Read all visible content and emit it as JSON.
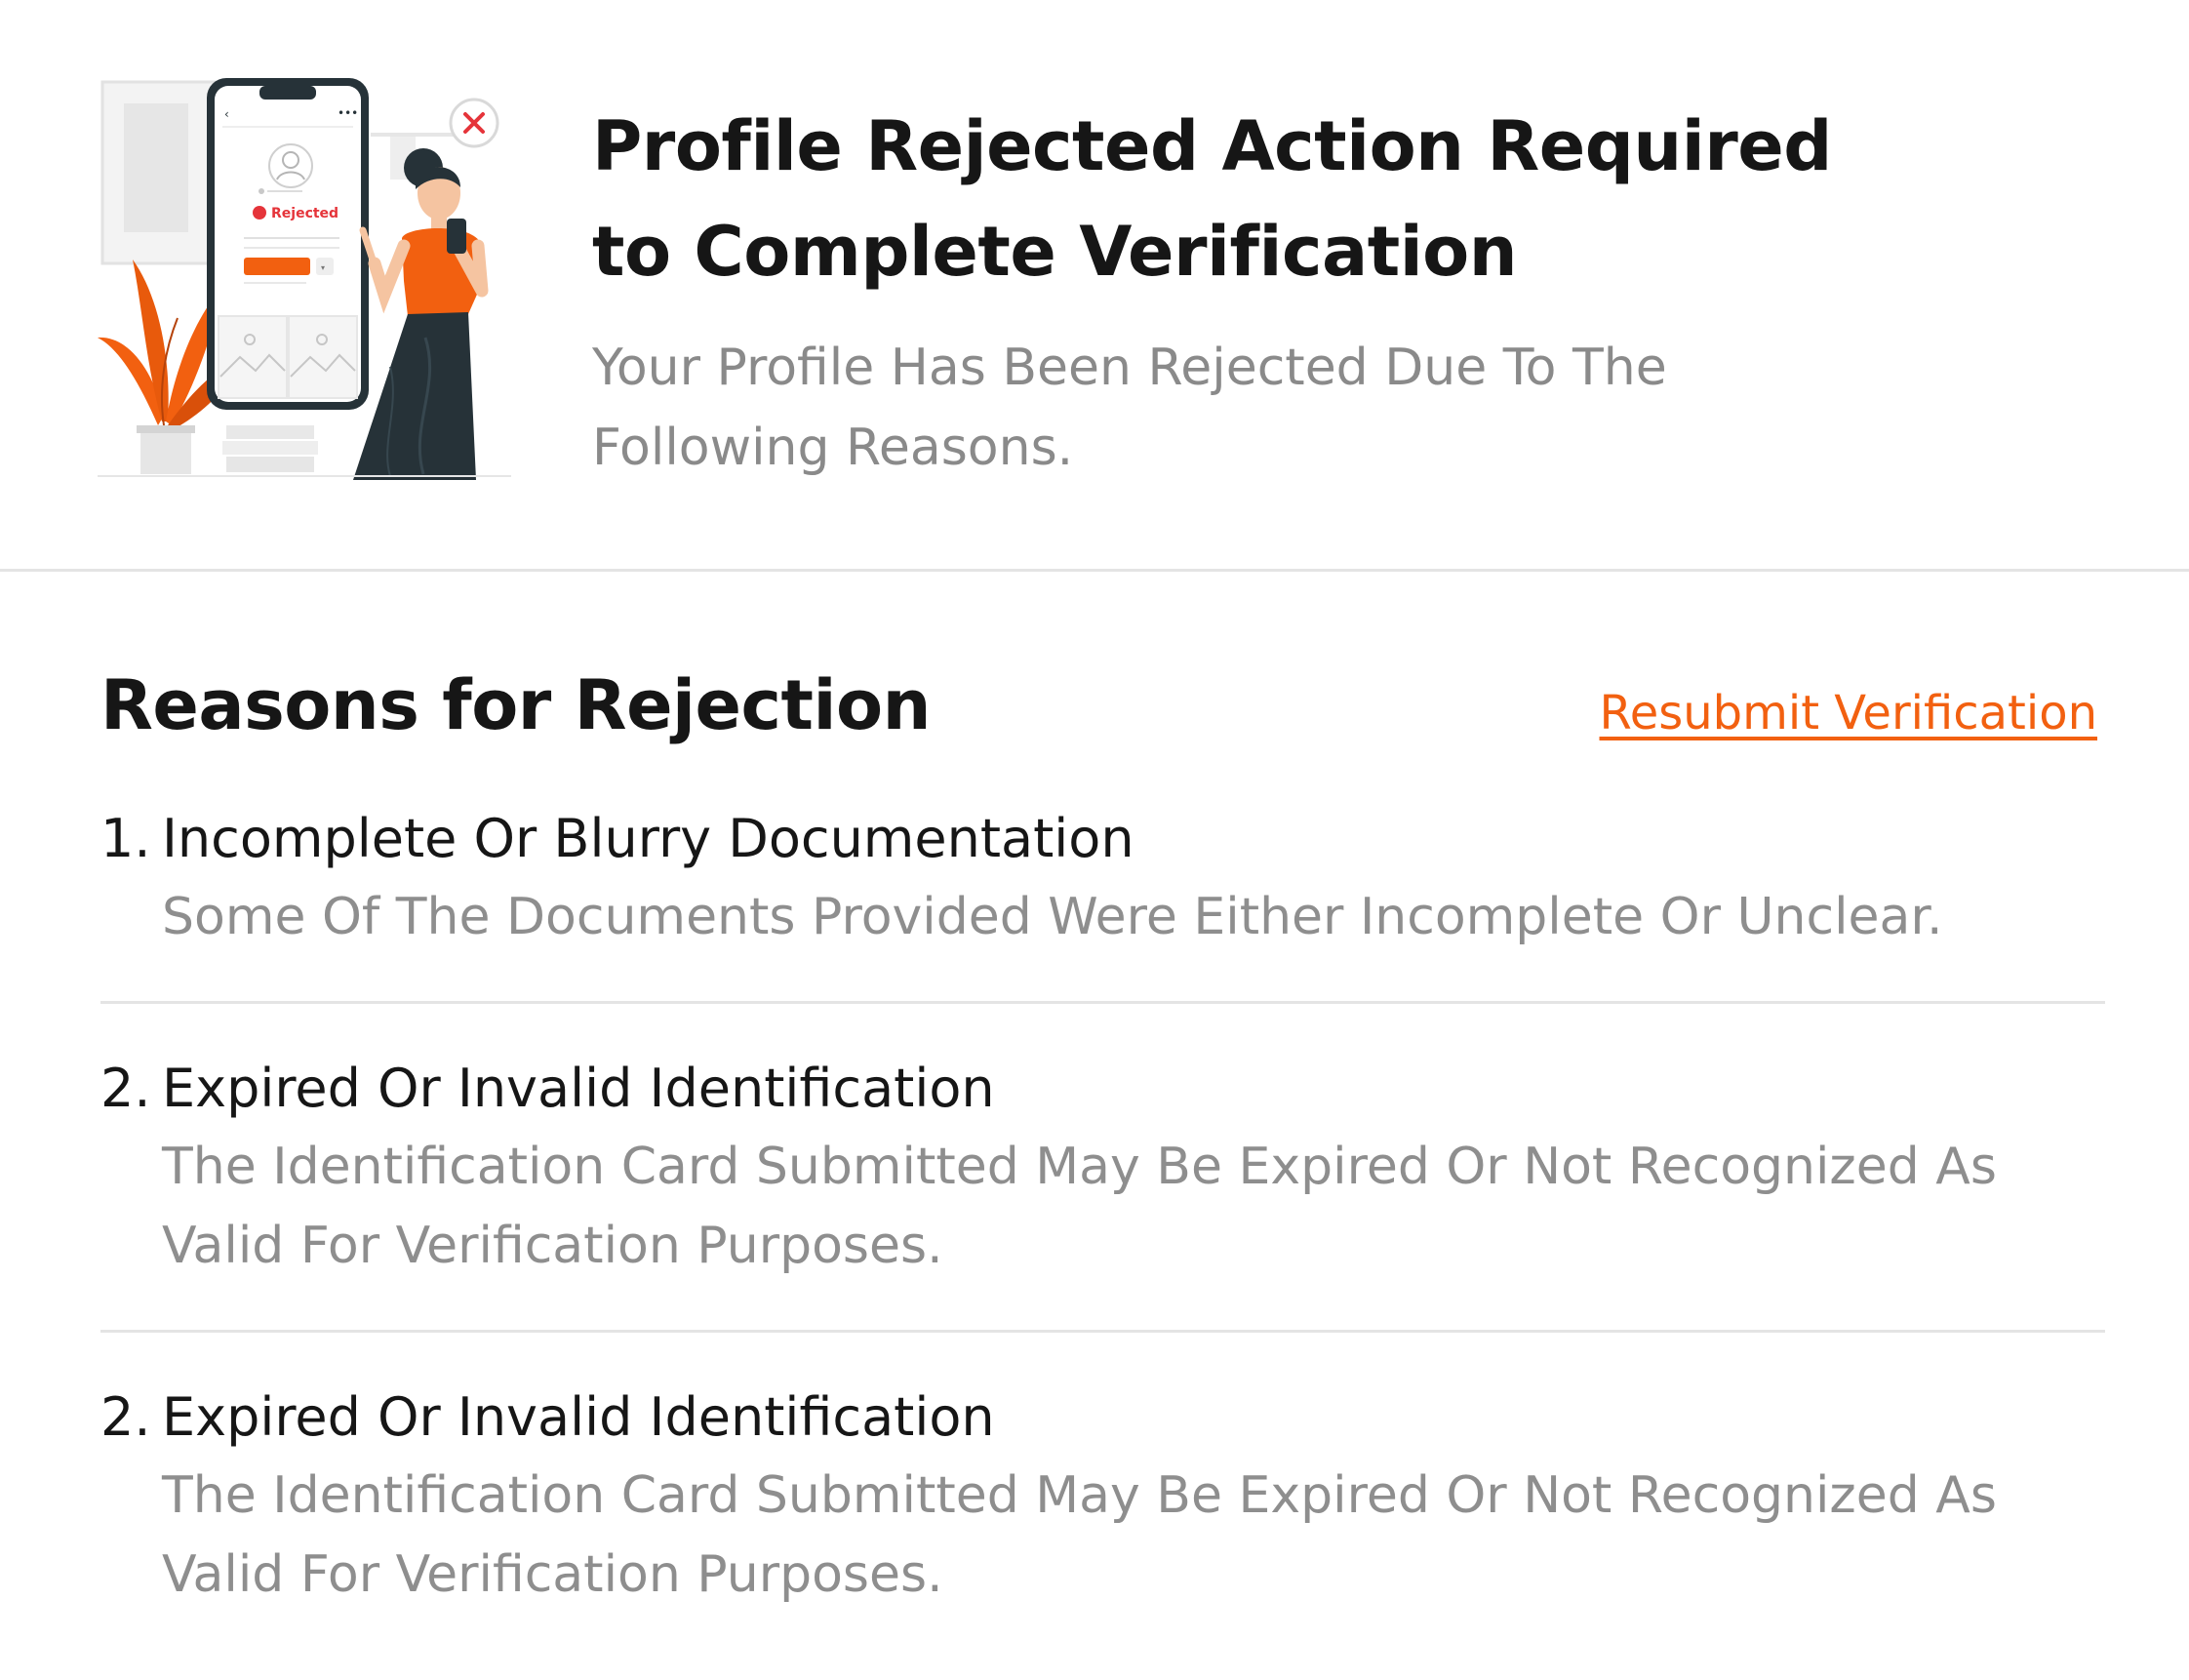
{
  "illustration": {
    "phone_status": "Rejected",
    "colors": {
      "accent": "#f26010",
      "reject_red": "#e5343a",
      "dark": "#263238"
    }
  },
  "hero": {
    "title_line1": "Profile Rejected Action Required",
    "title_line2": "to Complete Verification",
    "subtitle_line1": "Your Profile Has Been Rejected Due To The",
    "subtitle_line2": "Following Reasons."
  },
  "reasons": {
    "heading": "Reasons for Rejection",
    "resubmit_label": "Resubmit Verification",
    "items": [
      {
        "number": "1.",
        "title": "Incomplete Or Blurry Documentation",
        "description_lines": [
          "Some Of The Documents Provided Were Either Incomplete Or Unclear."
        ]
      },
      {
        "number": "2.",
        "title": "Expired Or Invalid Identification",
        "description_lines": [
          "The Identification Card Submitted May Be Expired Or Not Recognized As",
          "Valid For Verification Purposes."
        ]
      },
      {
        "number": "2.",
        "title": "Expired Or Invalid Identification",
        "description_lines": [
          "The Identification Card Submitted May Be Expired Or Not Recognized As",
          "Valid For Verification Purposes."
        ]
      }
    ]
  },
  "colors": {
    "link": "#f26010",
    "heading_text": "#161616",
    "muted_text": "#8a8a8a",
    "divider": "#e4e4e4"
  }
}
